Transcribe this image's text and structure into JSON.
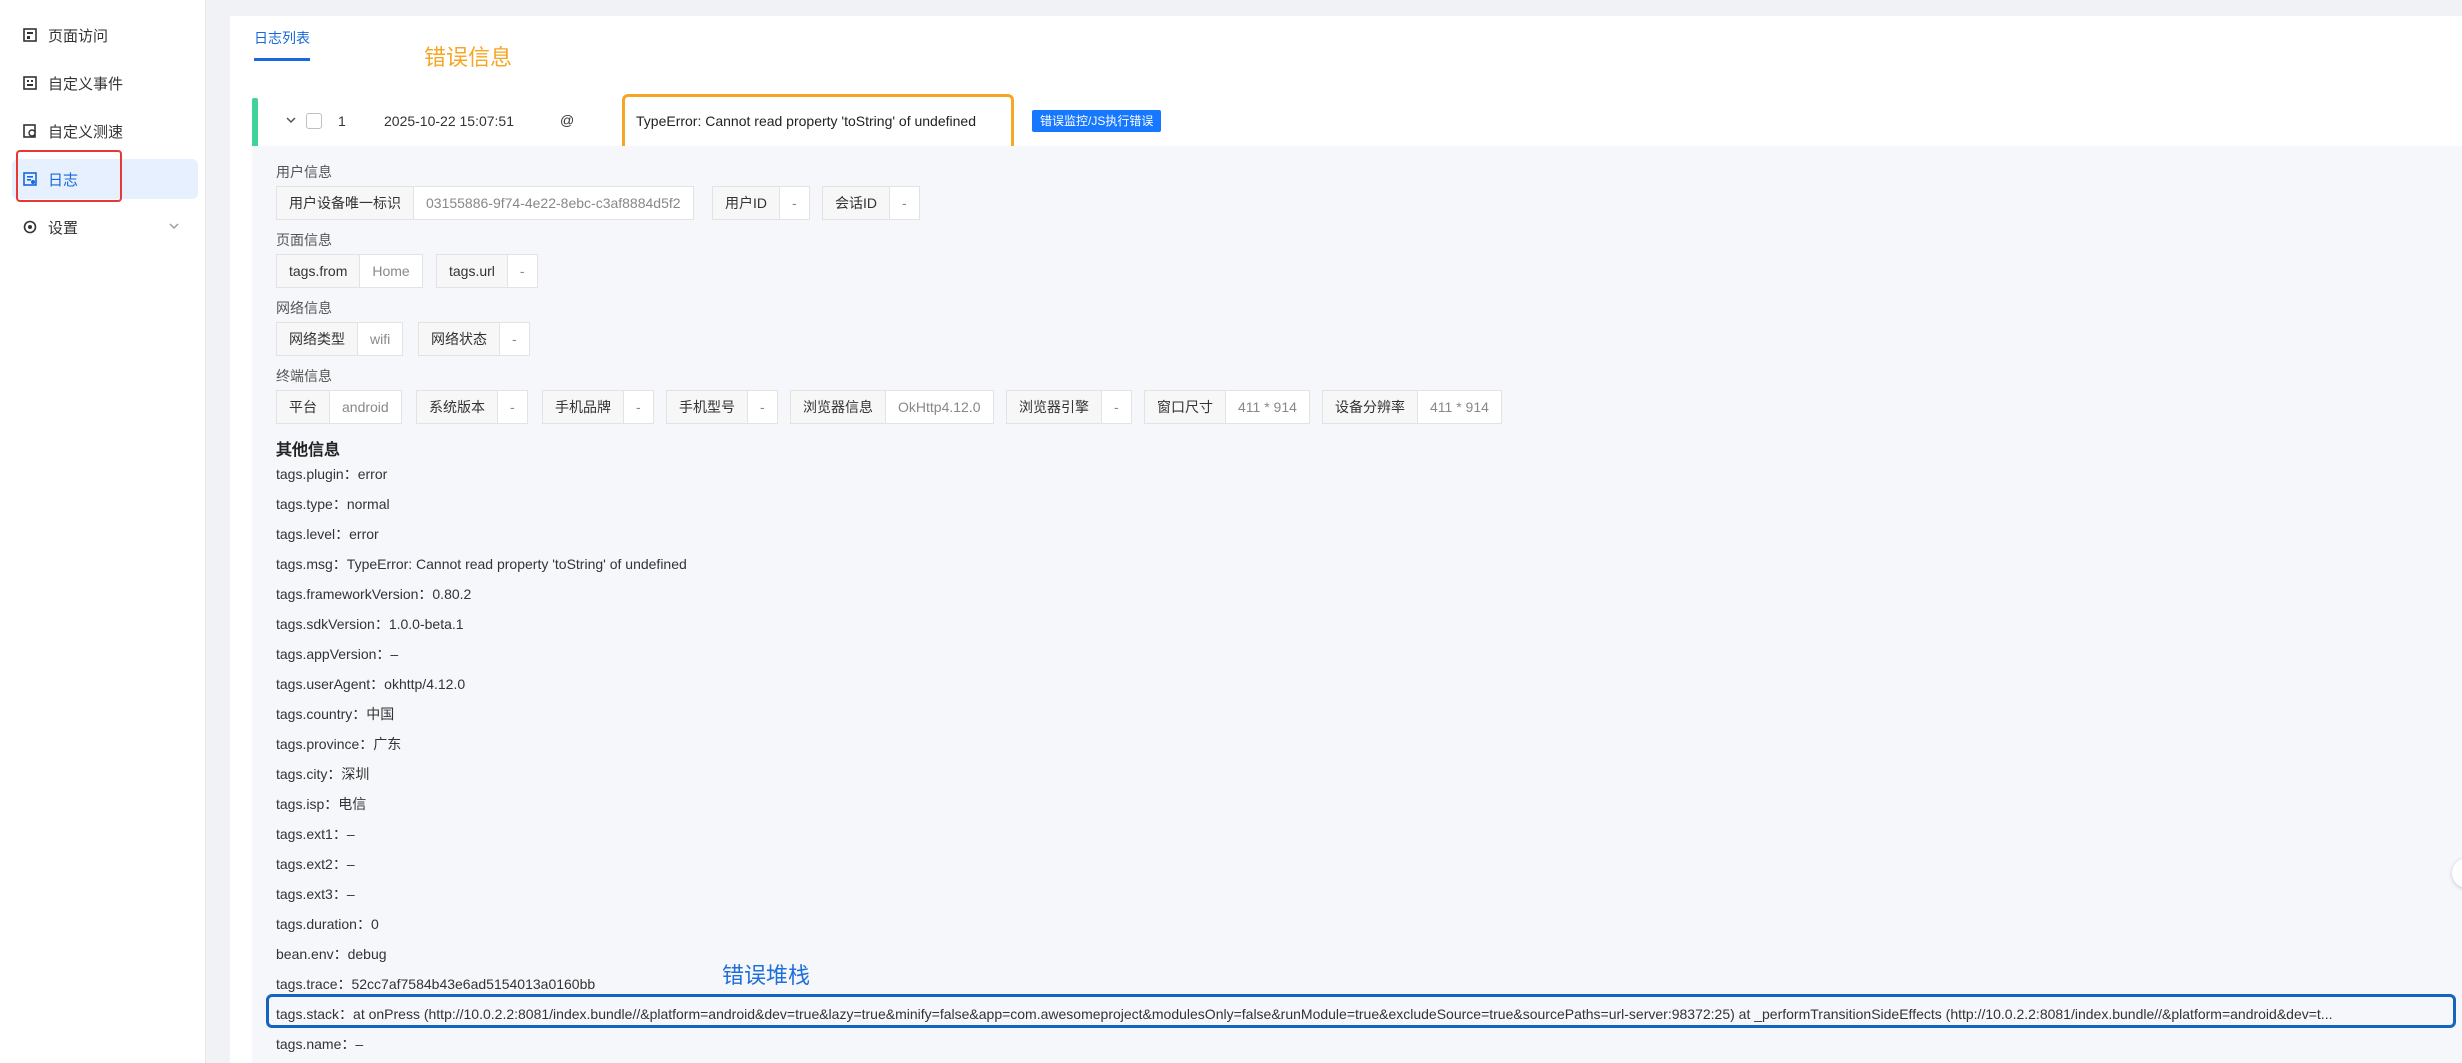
{
  "sidebar": {
    "items": [
      {
        "label": "页面访问",
        "icon": "page-visit-icon"
      },
      {
        "label": "自定义事件",
        "icon": "custom-event-icon"
      },
      {
        "label": "自定义测速",
        "icon": "custom-speed-icon"
      },
      {
        "label": "日志",
        "icon": "log-icon",
        "active": true
      },
      {
        "label": "设置",
        "icon": "settings-icon",
        "has_submenu": true
      }
    ]
  },
  "tabs": {
    "active": "日志列表"
  },
  "annotations": {
    "error_info": "错误信息",
    "error_stack": "错误堆栈"
  },
  "log_row": {
    "index": "1",
    "time": "2025-10-22 15:07:51",
    "at": "@",
    "message": "TypeError: Cannot read property 'toString' of undefined",
    "tag": "错误监控/JS执行错误"
  },
  "detail": {
    "user": {
      "title": "用户信息",
      "fields": [
        {
          "k": "用户设备唯一标识",
          "v": "03155886-9f74-4e22-8ebc-c3af8884d5f2"
        },
        {
          "k": "用户ID",
          "v": "-"
        },
        {
          "k": "会话ID",
          "v": "-"
        }
      ]
    },
    "page": {
      "title": "页面信息",
      "fields": [
        {
          "k": "tags.from",
          "v": "Home"
        },
        {
          "k": "tags.url",
          "v": "-"
        }
      ]
    },
    "network": {
      "title": "网络信息",
      "fields": [
        {
          "k": "网络类型",
          "v": "wifi"
        },
        {
          "k": "网络状态",
          "v": "-"
        }
      ]
    },
    "terminal": {
      "title": "终端信息",
      "fields": [
        {
          "k": "平台",
          "v": "android"
        },
        {
          "k": "系统版本",
          "v": "-"
        },
        {
          "k": "手机品牌",
          "v": "-"
        },
        {
          "k": "手机型号",
          "v": "-"
        },
        {
          "k": "浏览器信息",
          "v": "OkHttp4.12.0"
        },
        {
          "k": "浏览器引擎",
          "v": "-"
        },
        {
          "k": "窗口尺寸",
          "v": "411 * 914"
        },
        {
          "k": "设备分辨率",
          "v": "411 * 914"
        }
      ]
    },
    "other": {
      "title": "其他信息",
      "lines": [
        "tags.plugin：error",
        "tags.type：normal",
        "tags.level：error",
        "tags.msg：TypeError: Cannot read property 'toString' of undefined",
        "tags.frameworkVersion：0.80.2",
        "tags.sdkVersion：1.0.0-beta.1",
        "tags.appVersion：–",
        "tags.userAgent：okhttp/4.12.0",
        "tags.country：中国",
        "tags.province：广东",
        "tags.city：深圳",
        "tags.isp：电信",
        "tags.ext1：–",
        "tags.ext2：–",
        "tags.ext3：–",
        "tags.duration：0",
        "bean.env：debug",
        "tags.trace：52cc7af7584b43e6ad5154013a0160bb"
      ],
      "stack": "tags.stack：at onPress (http://10.0.2.2:8081/index.bundle//&platform=android&dev=true&lazy=true&minify=false&app=com.awesomeproject&modulesOnly=false&runModule=true&excludeSource=true&sourcePaths=url-server:98372:25) at _performTransitionSideEffects (http://10.0.2.2:8081/index.bundle//&platform=android&dev=t...",
      "name": "tags.name：–"
    }
  }
}
